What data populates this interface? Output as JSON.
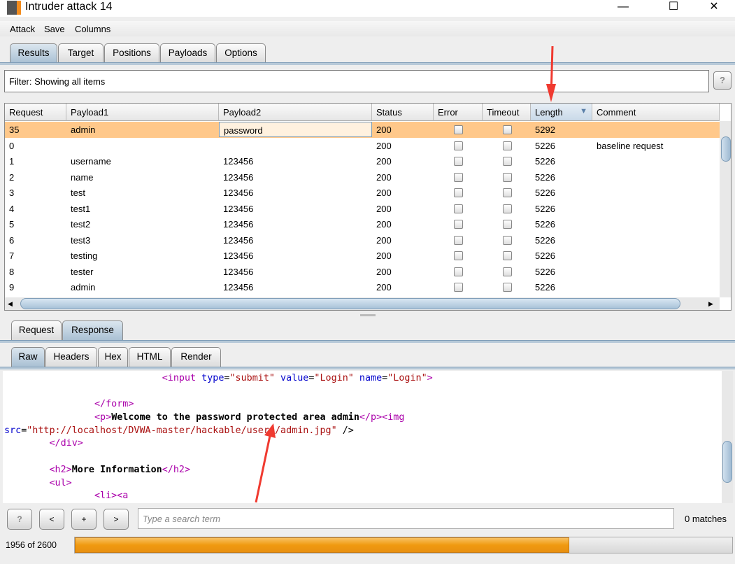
{
  "window": {
    "title": "Intruder attack 14",
    "minimize": "—",
    "maximize": "☐",
    "close": "✕"
  },
  "menu": [
    "Attack",
    "Save",
    "Columns"
  ],
  "tabs": [
    "Results",
    "Target",
    "Positions",
    "Payloads",
    "Options"
  ],
  "active_tab": "Results",
  "filter": {
    "text": "Filter:  Showing all items",
    "help": "?"
  },
  "table": {
    "columns": [
      "Request",
      "Payload1",
      "Payload2",
      "Status",
      "Error",
      "Timeout",
      "Length",
      "Comment"
    ],
    "sorted_column": "Length",
    "sort_icon": "▼",
    "rows": [
      [
        "35",
        "admin",
        "password",
        "200",
        false,
        false,
        "5292",
        ""
      ],
      [
        "0",
        "",
        "",
        "200",
        false,
        false,
        "5226",
        "baseline request"
      ],
      [
        "1",
        "username",
        "123456",
        "200",
        false,
        false,
        "5226",
        ""
      ],
      [
        "2",
        "name",
        "123456",
        "200",
        false,
        false,
        "5226",
        ""
      ],
      [
        "3",
        "test",
        "123456",
        "200",
        false,
        false,
        "5226",
        ""
      ],
      [
        "4",
        "test1",
        "123456",
        "200",
        false,
        false,
        "5226",
        ""
      ],
      [
        "5",
        "test2",
        "123456",
        "200",
        false,
        false,
        "5226",
        ""
      ],
      [
        "6",
        "test3",
        "123456",
        "200",
        false,
        false,
        "5226",
        ""
      ],
      [
        "7",
        "testing",
        "123456",
        "200",
        false,
        false,
        "5226",
        ""
      ],
      [
        "8",
        "tester",
        "123456",
        "200",
        false,
        false,
        "5226",
        ""
      ],
      [
        "9",
        "admin",
        "123456",
        "200",
        false,
        false,
        "5226",
        ""
      ]
    ],
    "selected_row": 0
  },
  "detail_tabs": [
    "Request",
    "Response"
  ],
  "active_detail_tab": "Response",
  "view_tabs": [
    "Raw",
    "Headers",
    "Hex",
    "HTML",
    "Render"
  ],
  "active_view_tab": "Raw",
  "code_lines": [
    [
      [
        "",
        "                            "
      ],
      [
        "t",
        "<input "
      ],
      [
        "a",
        "type"
      ],
      [
        "",
        "="
      ],
      [
        "v",
        "\"submit\""
      ],
      [
        "a",
        " value"
      ],
      [
        "",
        "="
      ],
      [
        "v",
        "\"Login\""
      ],
      [
        "a",
        " name"
      ],
      [
        "",
        "="
      ],
      [
        "v",
        "\"Login\""
      ],
      [
        "t",
        ">"
      ]
    ],
    [],
    [
      [
        "",
        "                "
      ],
      [
        "t",
        "</form>"
      ]
    ],
    [
      [
        "",
        "                "
      ],
      [
        "t",
        "<p>"
      ],
      [
        "b",
        "Welcome to the password protected area admin"
      ],
      [
        "t",
        "</p><img"
      ]
    ],
    [
      [
        "a",
        "src"
      ],
      [
        "",
        "="
      ],
      [
        "v",
        "\"http://localhost/DVWA-master/hackable/users/admin.jpg\""
      ],
      [
        "",
        " />"
      ]
    ],
    [
      [
        "",
        "        "
      ],
      [
        "t",
        "</div>"
      ]
    ],
    [],
    [
      [
        "",
        "        "
      ],
      [
        "t",
        "<h2>"
      ],
      [
        "b",
        "More Information"
      ],
      [
        "t",
        "</h2>"
      ]
    ],
    [
      [
        "",
        "        "
      ],
      [
        "t",
        "<ul>"
      ]
    ],
    [
      [
        "",
        "                "
      ],
      [
        "t",
        "<li><a"
      ]
    ]
  ],
  "search": {
    "placeholder": "Type a search term",
    "matches": "0 matches",
    "buttons": [
      "?",
      "<",
      "+",
      ">"
    ]
  },
  "progress": {
    "label": "1956 of 2600",
    "done": 1956,
    "total": 2600
  },
  "colors": {
    "selected_row": "#ffc88a",
    "progress": "#f09a10",
    "annotation_arrow": "#f03a30"
  }
}
